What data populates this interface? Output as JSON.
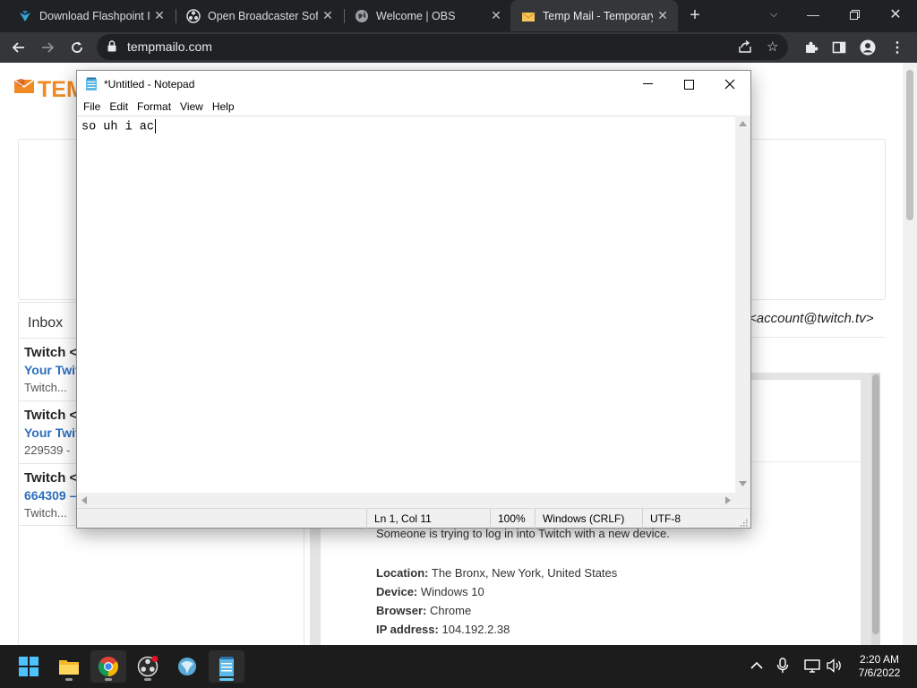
{
  "browser": {
    "tabs": [
      {
        "title": "Download Flashpoint In",
        "icon": "flashpoint-icon",
        "active": false
      },
      {
        "title": "Open Broadcaster Softw",
        "icon": "obs-icon",
        "active": false
      },
      {
        "title": "Welcome | OBS",
        "icon": "globe-icon",
        "active": false
      },
      {
        "title": "Temp Mail - Temporary",
        "icon": "mail-envelope-icon",
        "active": true
      }
    ],
    "url": "tempmailo.com"
  },
  "page": {
    "logo_text": "TEM",
    "inbox_label": "Inbox",
    "from_address": "<account@twitch.tv>",
    "messages": [
      {
        "sender": "Twitch <",
        "subject": "Your Twit",
        "preview": "Twitch..."
      },
      {
        "sender": "Twitch <",
        "subject": "Your Twit",
        "preview": "229539 - "
      },
      {
        "sender": "Twitch <",
        "subject": "664309 –",
        "preview": "Twitch..."
      }
    ],
    "email": {
      "intro": "Someone is trying to log in into Twitch with a new device.",
      "details": [
        {
          "label": "Location:",
          "value": "The Bronx, New York, United States"
        },
        {
          "label": "Device:",
          "value": "Windows 10"
        },
        {
          "label": "Browser:",
          "value": "Chrome"
        },
        {
          "label": "IP address:",
          "value": "104.192.2.38"
        }
      ]
    }
  },
  "notepad": {
    "title": "*Untitled - Notepad",
    "menu": [
      "File",
      "Edit",
      "Format",
      "View",
      "Help"
    ],
    "content": "so uh i ac",
    "status": {
      "position": "Ln 1, Col 11",
      "zoom": "100%",
      "line_endings": "Windows (CRLF)",
      "encoding": "UTF-8"
    }
  },
  "taskbar": {
    "time": "2:20 AM",
    "date": "7/6/2022"
  },
  "colors": {
    "accent_blue": "#1a73e8",
    "link_blue": "#2d6fbf",
    "brand_orange": "#f08a24"
  }
}
